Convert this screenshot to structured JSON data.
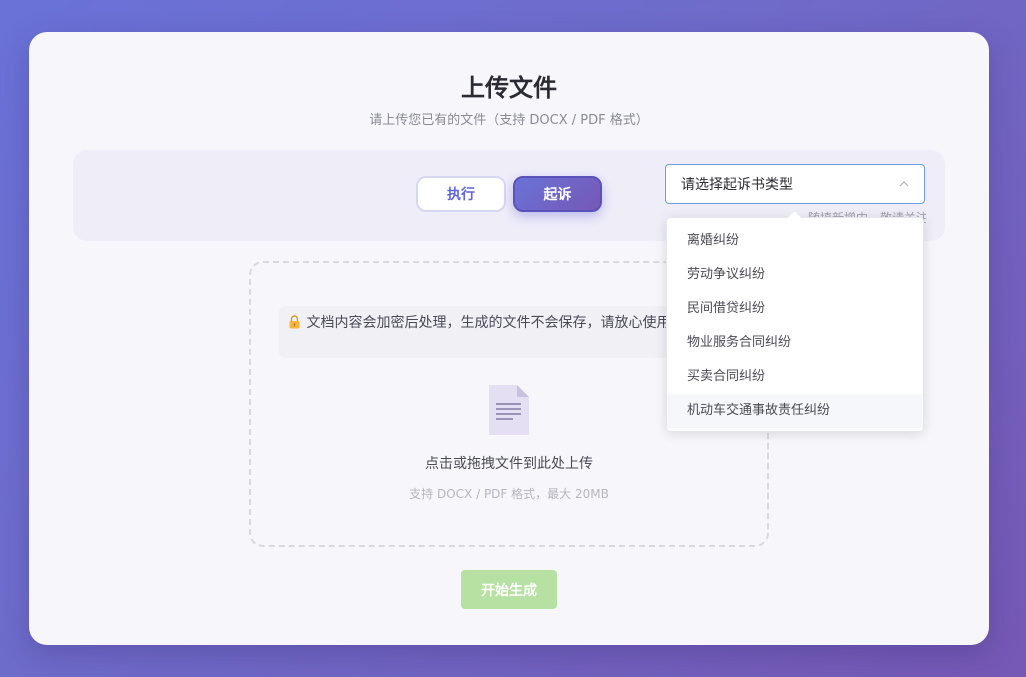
{
  "page": {
    "title": "上传文件",
    "subtitle": "请上传您已有的文件（支持 DOCX / PDF 格式）"
  },
  "tabs": {
    "execute_label": "执行",
    "sue_label": "起诉",
    "active": "起诉"
  },
  "select": {
    "placeholder": "请选择起诉书类型",
    "hint_partial": "随填新增中，敬请关注",
    "options": [
      "离婚纠纷",
      "劳动争议纠纷",
      "民间借贷纠纷",
      "物业服务合同纠纷",
      "买卖合同纠纷",
      "机动车交通事故责任纠纷"
    ],
    "hovered_option": "机动车交通事故责任纠纷"
  },
  "upload": {
    "notice": "文档内容会加密后处理，生成的文件不会保存，请放心使用",
    "drop_text": "点击或拖拽文件到此处上传",
    "drop_sub": "支持 DOCX / PDF 格式，最大 20MB"
  },
  "actions": {
    "generate_label": "开始生成"
  },
  "colors": {
    "accent": "#6a72d8",
    "accent_dark": "#7658b5",
    "generate_disabled": "#b6e1a2",
    "select_border": "#6a9fe0"
  },
  "icons": {
    "lock": "lock-icon",
    "file": "document-icon",
    "chevron": "chevron-up-icon"
  }
}
